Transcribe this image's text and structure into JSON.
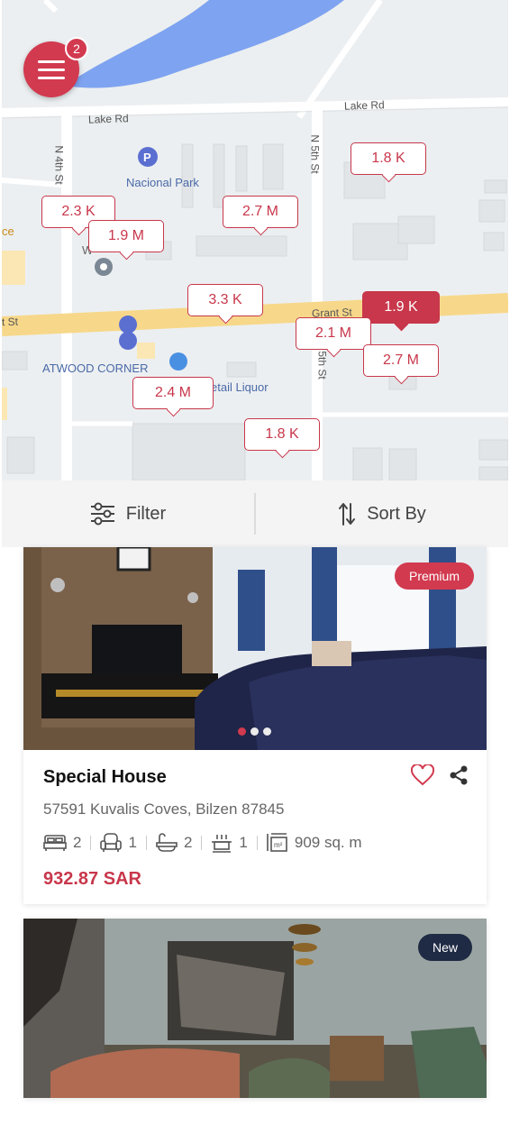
{
  "menu": {
    "badge_count": "2"
  },
  "map": {
    "roads": {
      "lake_rd_left": "Lake Rd",
      "lake_rd_right": "Lake Rd",
      "n_4th_st": "N 4th St",
      "n_5th_st": "N 5th St",
      "grant_st": "Grant St",
      "grant_st_left": "t St",
      "s_5th_st": "5th St"
    },
    "pois": {
      "nacional_park": "Nacional Park",
      "atwood_corner": "ATWOOD CORNER",
      "retail_liquor": "etail Liquor",
      "left_edge": "ce",
      "w_label": "W"
    },
    "price_pins": [
      {
        "label": "1.8 K",
        "active": false
      },
      {
        "label": "2.3 K",
        "active": false
      },
      {
        "label": "2.7 M",
        "active": false
      },
      {
        "label": "1.9 M",
        "active": false
      },
      {
        "label": "3.3 K",
        "active": false
      },
      {
        "label": "1.9 K",
        "active": true
      },
      {
        "label": "2.1 M",
        "active": false
      },
      {
        "label": "2.7 M",
        "active": false
      },
      {
        "label": "2.4 M",
        "active": false
      },
      {
        "label": "1.8 K",
        "active": false
      }
    ]
  },
  "toolbar": {
    "filter_label": "Filter",
    "sort_label": "Sort By"
  },
  "listings": [
    {
      "tag": "Premium",
      "title": "Special House",
      "address": "57591 Kuvalis Coves, Bilzen 87845",
      "features": {
        "bedrooms": "2",
        "living": "1",
        "bathrooms": "2",
        "kitchen": "1",
        "area": "909 sq. m"
      },
      "price": "932.87 SAR",
      "photo_count": 3,
      "active_photo": 0
    },
    {
      "tag": "New"
    }
  ],
  "colors": {
    "accent": "#d23a4f",
    "price": "#c8374b",
    "new_tag": "#1f2a44",
    "map_road": "#ffffff",
    "map_main_road": "#f7d88a",
    "water": "#7ea3f0"
  }
}
